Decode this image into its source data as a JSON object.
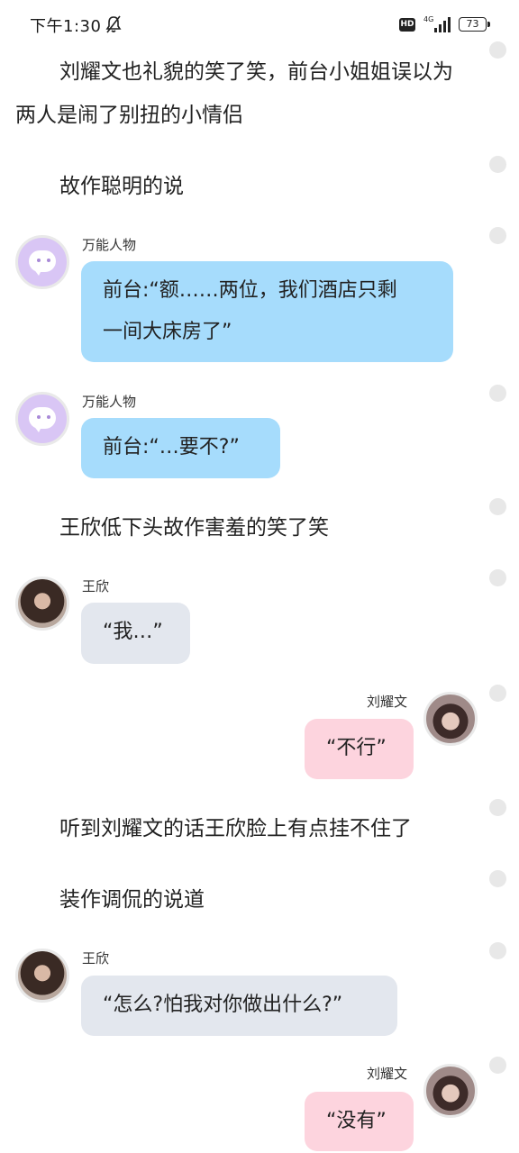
{
  "status_bar": {
    "time": "下午1:30",
    "hd": "HD",
    "network": "4G",
    "battery": "73"
  },
  "messages": [
    {
      "kind": "narration",
      "text_line1": "刘耀文也礼貌的笑了笑，前台小姐姐误以为",
      "text_line2": "两人是闹了别扭的小情侣"
    },
    {
      "kind": "narration",
      "text": "故作聪明的说"
    },
    {
      "kind": "chat",
      "side": "left",
      "sender": "万能人物",
      "text_line1": "前台:“额……两位，我们酒店只剩",
      "text_line2": "一间大床房了”"
    },
    {
      "kind": "chat",
      "side": "left",
      "sender": "万能人物",
      "text": "前台:“…要不?”"
    },
    {
      "kind": "narration",
      "text": "王欣低下头故作害羞的笑了笑"
    },
    {
      "kind": "chat",
      "side": "left",
      "sender": "王欣",
      "text": "“我…”"
    },
    {
      "kind": "chat",
      "side": "right",
      "sender": "刘耀文",
      "text": "“不行”"
    },
    {
      "kind": "narration",
      "text": "听到刘耀文的话王欣脸上有点挂不住了"
    },
    {
      "kind": "narration",
      "text": "装作调侃的说道"
    },
    {
      "kind": "chat",
      "side": "left",
      "sender": "王欣",
      "text": "“怎么?怕我对你做出什么?”"
    },
    {
      "kind": "chat",
      "side": "right",
      "sender": "刘耀文",
      "text": "“没有”"
    }
  ],
  "colors": {
    "bubble_bot": "#a6dcfc",
    "bubble_wangxin": "#e3e7ee",
    "bubble_liuyaowen": "#fdd4de",
    "bot_avatar": "#d9c6f5"
  },
  "icons": {
    "bell": "bell-muted-icon",
    "signal": "signal-icon",
    "battery": "battery-icon",
    "bot_avatar": "chat-bubble-face-icon"
  }
}
